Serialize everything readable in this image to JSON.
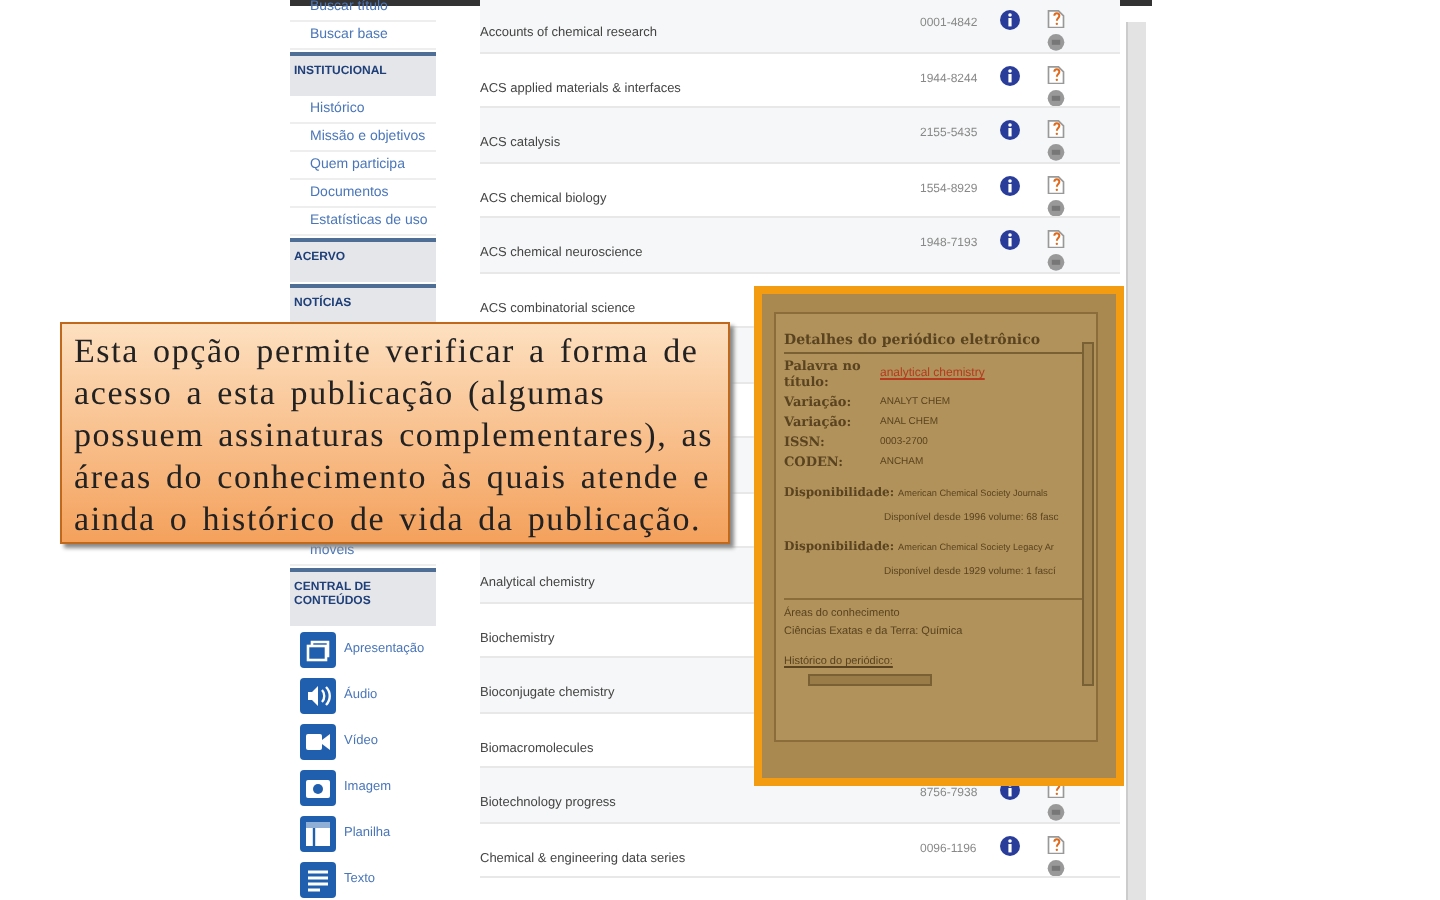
{
  "sidebar": {
    "items": [
      {
        "kind": "link",
        "label": "Buscar título"
      },
      {
        "kind": "link",
        "label": "Buscar base"
      },
      {
        "kind": "header",
        "label": "INSTITUCIONAL"
      },
      {
        "kind": "link",
        "label": "Histórico"
      },
      {
        "kind": "link",
        "label": "Missão e objetivos"
      },
      {
        "kind": "link",
        "label": "Quem participa"
      },
      {
        "kind": "link",
        "label": "Documentos"
      },
      {
        "kind": "link",
        "label": "Estatísticas de uso"
      },
      {
        "kind": "header",
        "label": "ACERVO"
      },
      {
        "kind": "header",
        "label": "NOTÍCIAS"
      },
      {
        "kind": "gap"
      },
      {
        "kind": "link",
        "label": "móveis"
      },
      {
        "kind": "header",
        "label": "CENTRAL DE CONTEÚDOS"
      },
      {
        "kind": "media",
        "label": "Apresentação"
      },
      {
        "kind": "media",
        "label": "Áudio"
      },
      {
        "kind": "media",
        "label": "Vídeo"
      },
      {
        "kind": "media",
        "label": "Imagem"
      },
      {
        "kind": "media",
        "label": "Planilha"
      },
      {
        "kind": "media",
        "label": "Texto"
      }
    ]
  },
  "journals": {
    "rows": [
      {
        "title": "Accounts of chemical research",
        "issn": "0001-4842"
      },
      {
        "title": "ACS applied materials & interfaces",
        "issn": "1944-8244"
      },
      {
        "title": "ACS catalysis",
        "issn": "2155-5435"
      },
      {
        "title": "ACS chemical biology",
        "issn": "1554-8929"
      },
      {
        "title": "ACS chemical neuroscience",
        "issn": "1948-7193"
      },
      {
        "title": "ACS combinatorial science"
      },
      {},
      {},
      {},
      {},
      {
        "title": "Analytical chemistry"
      },
      {
        "title": "Biochemistry"
      },
      {
        "title": "Bioconjugate chemistry"
      },
      {
        "title": "Biomacromolecules"
      },
      {
        "title": "Biotechnology progress",
        "issn": "8756-7938"
      },
      {
        "title": "Chemical & engineering data series",
        "issn": "0096-1196"
      }
    ]
  },
  "details_popup": {
    "title": "Detalhes do periódico eletrônico",
    "fields": [
      {
        "kind": "link",
        "label": "Palavra no título:",
        "value": "analytical chemistry"
      },
      {
        "kind": "text",
        "label": "Variação:",
        "value": "ANALYT CHEM"
      },
      {
        "kind": "text",
        "label": "Variação:",
        "value": "ANAL CHEM"
      },
      {
        "kind": "text",
        "label": "ISSN:",
        "value": "0003-2700"
      },
      {
        "kind": "text",
        "label": "CODEN:",
        "value": "ANCHAM"
      }
    ],
    "availability": [
      {
        "label": "Disponibilidade:",
        "source": "American Chemical Society Journals",
        "coverage": "Disponível desde 1996 volume: 68 fasc"
      },
      {
        "label": "Disponibilidade:",
        "source": "American Chemical Society Legacy Ar",
        "coverage": "Disponível desde 1929 volume: 1 fascí"
      }
    ],
    "areas_label": "Áreas do conhecimento",
    "areas_value": "Ciências Exatas e da Terra: Química",
    "history_label": "Histórico do periódico:"
  },
  "callout": {
    "text": "Esta opção permite verificar a forma de acesso a esta publicação (algumas possuem assinaturas complementares), as áreas do conhecimento às quais atende e ainda o histórico de vida da publicação."
  }
}
